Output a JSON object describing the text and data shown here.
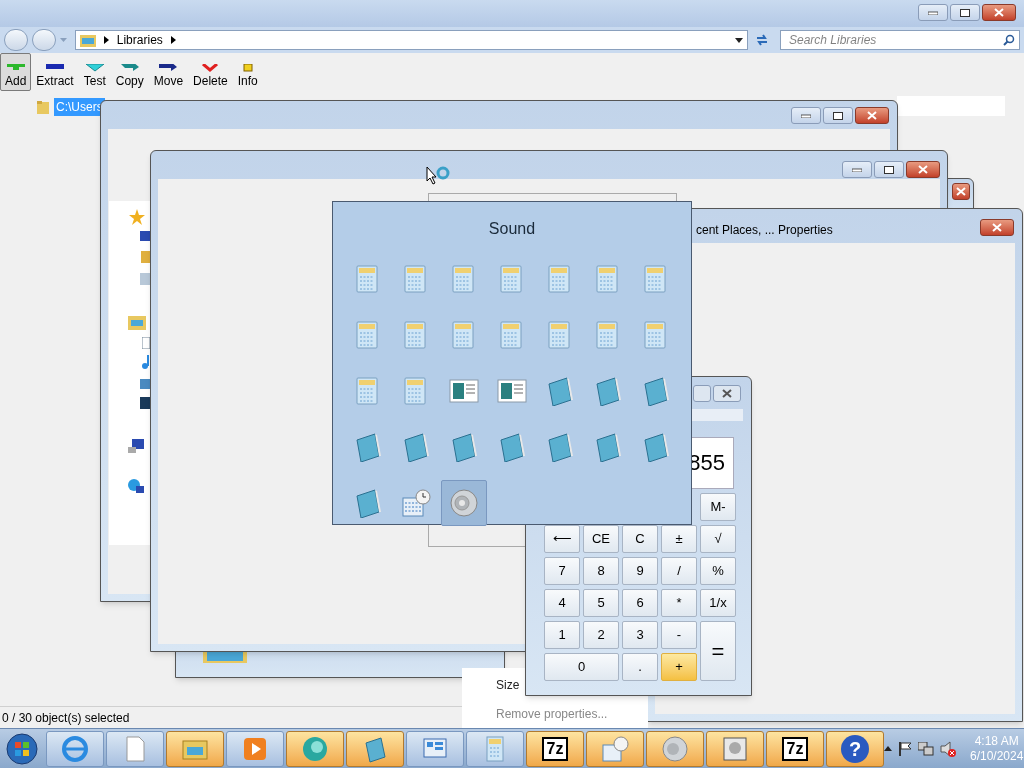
{
  "explorer": {
    "breadcrumb": "Libraries",
    "search": {
      "placeholder": "Search Libraries"
    },
    "toolbar": [
      {
        "label": "Add",
        "kind": "add",
        "selected": true
      },
      {
        "label": "Extract",
        "kind": "extract",
        "selected": false
      },
      {
        "label": "Test",
        "kind": "test",
        "selected": false
      },
      {
        "label": "Copy",
        "kind": "copy",
        "selected": false
      },
      {
        "label": "Move",
        "kind": "move",
        "selected": false
      },
      {
        "label": "Delete",
        "kind": "delete",
        "selected": false
      },
      {
        "label": "Info",
        "kind": "info",
        "selected": false
      }
    ],
    "tree_item": {
      "label": "C:\\Users",
      "selected": true
    },
    "status": "0 / 30 object(s) selected"
  },
  "properties": {
    "title": "cent Places, ... Properties",
    "details": [
      {
        "text": "Size",
        "disabled": false
      },
      {
        "text": "Remove properties...",
        "disabled": true
      }
    ]
  },
  "calculator": {
    "display": "855",
    "keys": [
      {
        "label": "M-",
        "kind": "memory",
        "hover": false
      },
      {
        "label": "⟵",
        "kind": "normal",
        "hover": false
      },
      {
        "label": "CE",
        "kind": "normal",
        "hover": false
      },
      {
        "label": "C",
        "kind": "normal",
        "hover": false
      },
      {
        "label": "±",
        "kind": "normal",
        "hover": false
      },
      {
        "label": "√",
        "kind": "normal",
        "hover": false
      },
      {
        "label": "7",
        "kind": "normal",
        "hover": false
      },
      {
        "label": "8",
        "kind": "normal",
        "hover": false
      },
      {
        "label": "9",
        "kind": "normal",
        "hover": false
      },
      {
        "label": "/",
        "kind": "normal",
        "hover": false
      },
      {
        "label": "%",
        "kind": "normal",
        "hover": false
      },
      {
        "label": "4",
        "kind": "normal",
        "hover": false
      },
      {
        "label": "5",
        "kind": "normal",
        "hover": false
      },
      {
        "label": "6",
        "kind": "normal",
        "hover": false
      },
      {
        "label": "*",
        "kind": "normal",
        "hover": false
      },
      {
        "label": "1/x",
        "kind": "normal",
        "hover": false
      },
      {
        "label": "1",
        "kind": "normal",
        "hover": false
      },
      {
        "label": "2",
        "kind": "normal",
        "hover": false
      },
      {
        "label": "3",
        "kind": "normal",
        "hover": false
      },
      {
        "label": "-",
        "kind": "normal",
        "hover": false
      },
      {
        "label": "=",
        "kind": "tall",
        "hover": false
      },
      {
        "label": "0",
        "kind": "wide",
        "hover": false
      },
      {
        "label": ".",
        "kind": "normal",
        "hover": false
      },
      {
        "label": "+",
        "kind": "normal",
        "hover": true
      }
    ]
  },
  "switcher": {
    "title": "Sound",
    "items": [
      {
        "kind": "calculator",
        "selected": false
      },
      {
        "kind": "calculator",
        "selected": false
      },
      {
        "kind": "calculator",
        "selected": false
      },
      {
        "kind": "calculator",
        "selected": false
      },
      {
        "kind": "calculator",
        "selected": false
      },
      {
        "kind": "calculator",
        "selected": false
      },
      {
        "kind": "calculator",
        "selected": false
      },
      {
        "kind": "calculator",
        "selected": false
      },
      {
        "kind": "calculator",
        "selected": false
      },
      {
        "kind": "calculator",
        "selected": false
      },
      {
        "kind": "calculator",
        "selected": false
      },
      {
        "kind": "calculator",
        "selected": false
      },
      {
        "kind": "calculator",
        "selected": false
      },
      {
        "kind": "calculator",
        "selected": false
      },
      {
        "kind": "calculator",
        "selected": false
      },
      {
        "kind": "calculator",
        "selected": false
      },
      {
        "kind": "document",
        "selected": false
      },
      {
        "kind": "document",
        "selected": false
      },
      {
        "kind": "notepad",
        "selected": false
      },
      {
        "kind": "notepad",
        "selected": false
      },
      {
        "kind": "notepad",
        "selected": false
      },
      {
        "kind": "notepad",
        "selected": false
      },
      {
        "kind": "notepad",
        "selected": false
      },
      {
        "kind": "notepad",
        "selected": false
      },
      {
        "kind": "notepad",
        "selected": false
      },
      {
        "kind": "notepad",
        "selected": false
      },
      {
        "kind": "notepad",
        "selected": false
      },
      {
        "kind": "notepad",
        "selected": false
      },
      {
        "kind": "notepad",
        "selected": false
      },
      {
        "kind": "scheduler",
        "selected": false
      },
      {
        "kind": "speaker",
        "selected": true
      }
    ]
  },
  "taskbar": {
    "items": [
      {
        "kind": "browser",
        "active": false
      },
      {
        "kind": "document",
        "active": false
      },
      {
        "kind": "folder",
        "active": true
      },
      {
        "kind": "media",
        "active": false
      },
      {
        "kind": "globe",
        "active": true
      },
      {
        "kind": "notepad",
        "active": true
      },
      {
        "kind": "panel",
        "active": false
      },
      {
        "kind": "calculator",
        "active": false
      },
      {
        "kind": "archive",
        "label": "7z",
        "active": true
      },
      {
        "kind": "scheduler",
        "active": true
      },
      {
        "kind": "speaker",
        "active": true
      },
      {
        "kind": "photo",
        "active": true
      },
      {
        "kind": "archive",
        "label": "7z",
        "active": true
      },
      {
        "kind": "help",
        "label": "?",
        "active": true
      }
    ],
    "clock": {
      "time": "4:18 AM",
      "date": "6/10/2024"
    }
  }
}
